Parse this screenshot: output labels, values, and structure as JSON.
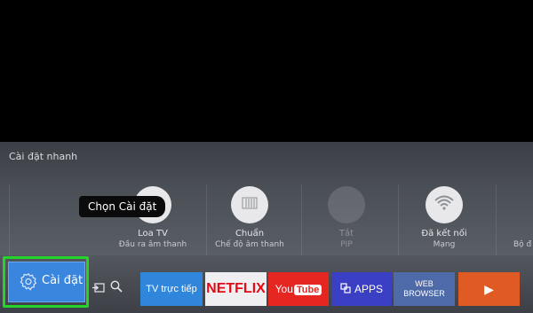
{
  "quick_settings": {
    "title": "Cài đặt nhanh",
    "items": [
      {
        "label": "Loa TV",
        "sublabel": "Đầu ra âm thanh",
        "icon": "speaker-icon"
      },
      {
        "label": "Chuẩn",
        "sublabel": "Chế độ âm thanh",
        "icon": "sound-mode-icon"
      },
      {
        "label": "Tắt",
        "sublabel": "PIP",
        "icon": "pip-icon"
      },
      {
        "label": "Đã kết nối",
        "sublabel": "Mạng",
        "icon": "wifi-icon"
      },
      {
        "label": "",
        "sublabel": "Bộ đ",
        "icon": "timer-icon"
      }
    ]
  },
  "tooltip": {
    "text": "Chọn Cài đặt"
  },
  "bottom_bar": {
    "settings_label": "Cài đặt",
    "apps": [
      {
        "label": "TV trực tiếp"
      },
      {
        "label": "NETFLIX"
      },
      {
        "label_you": "You",
        "label_tube": "Tube"
      },
      {
        "label": "APPS"
      },
      {
        "label_line1": "WEB",
        "label_line2": "BROWSER"
      },
      {
        "label": "▶"
      }
    ]
  },
  "colors": {
    "highlight": "#25d42b",
    "settings_button": "#3a86df",
    "netflix_red": "#e50914",
    "youtube_red": "#e52621",
    "apps_blue": "#3b3fc4",
    "web_blue": "#4f6aa8",
    "play_orange": "#e05a24",
    "tv_blue": "#2f86db"
  }
}
